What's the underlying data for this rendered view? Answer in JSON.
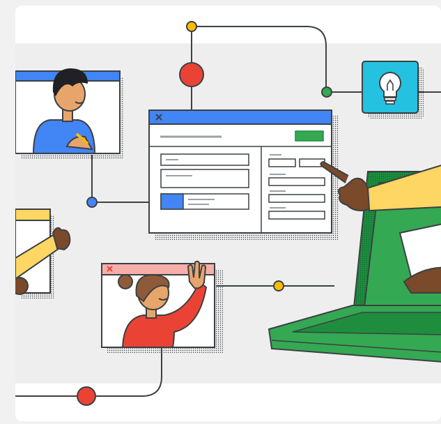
{
  "illustration": {
    "description_free": true,
    "colors": {
      "panel_bg": "#eeeeee",
      "card_bg": "#ffffff",
      "blue": "#4285f4",
      "red": "#ea4335",
      "yellow": "#fbbc04",
      "green": "#34a853",
      "dark_green": "#1e8e3e",
      "teal": "#24c1e0",
      "salmon": "#f6aea9",
      "outline": "#3c4043",
      "skin_tan": "#e8a56b",
      "skin_dark": "#7a4a2b",
      "hair_dark": "#202124",
      "hair_brown": "#8d5b3a",
      "sleeve_yellow": "#fdd663"
    },
    "icons": [
      "lightbulb-icon",
      "close-icon"
    ]
  }
}
